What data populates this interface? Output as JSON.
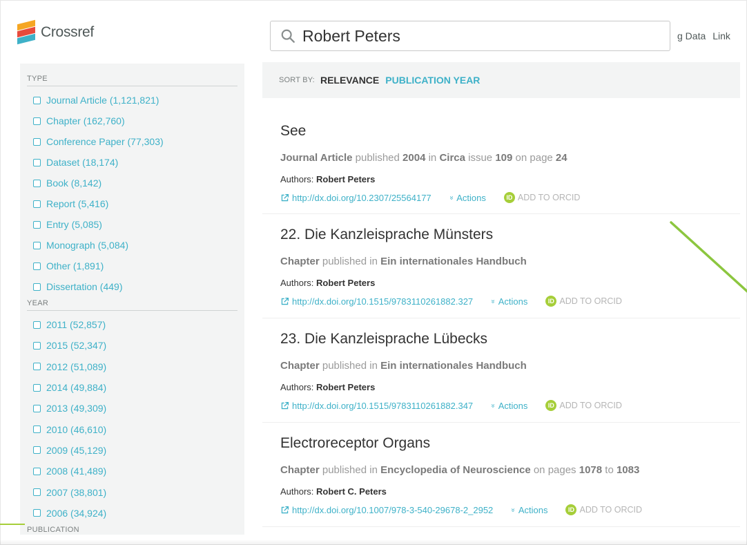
{
  "brand": {
    "name": "Crossref"
  },
  "search": {
    "query": "Robert Peters"
  },
  "top_nav": {
    "items": [
      "g Data",
      "Link"
    ]
  },
  "sidebar": {
    "type_heading": "TYPE",
    "type_items": [
      "Journal Article (1,121,821)",
      "Chapter (162,760)",
      "Conference Paper (77,303)",
      "Dataset (18,174)",
      "Book (8,142)",
      "Report (5,416)",
      "Entry (5,085)",
      "Monograph (5,084)",
      "Other (1,891)",
      "Dissertation (449)"
    ],
    "year_heading": "YEAR",
    "year_items": [
      "2011 (52,857)",
      "2015 (52,347)",
      "2012 (51,089)",
      "2014 (49,884)",
      "2013 (49,309)",
      "2010 (46,610)",
      "2009 (45,129)",
      "2008 (41,489)",
      "2007 (38,801)",
      "2006 (34,924)"
    ],
    "publication_heading": "PUBLICATION"
  },
  "sort": {
    "label": "SORT BY:",
    "active": "RELEVANCE",
    "alternate": "PUBLICATION YEAR"
  },
  "common": {
    "authors_label": "Authors:",
    "actions_label": "Actions",
    "orcid_label": "ADD TO ORCID",
    "orcid_badge": "iD"
  },
  "results": [
    {
      "title": "See",
      "meta": [
        {
          "text": "Journal Article",
          "bold": true
        },
        {
          "text": " published ",
          "bold": false
        },
        {
          "text": "2004",
          "bold": true
        },
        {
          "text": " in ",
          "bold": false
        },
        {
          "text": "Circa",
          "bold": true
        },
        {
          "text": " issue ",
          "bold": false
        },
        {
          "text": "109",
          "bold": true
        },
        {
          "text": " on page ",
          "bold": false
        },
        {
          "text": "24",
          "bold": true
        }
      ],
      "authors": "Robert Peters",
      "doi": "http://dx.doi.org/10.2307/25564177"
    },
    {
      "title": "22. Die Kanzleisprache Münsters",
      "meta": [
        {
          "text": "Chapter",
          "bold": true
        },
        {
          "text": " published in ",
          "bold": false
        },
        {
          "text": "Ein internationales Handbuch",
          "bold": true
        }
      ],
      "authors": "Robert Peters",
      "doi": "http://dx.doi.org/10.1515/9783110261882.327"
    },
    {
      "title": "23. Die Kanzleisprache Lübecks",
      "meta": [
        {
          "text": "Chapter",
          "bold": true
        },
        {
          "text": " published in ",
          "bold": false
        },
        {
          "text": "Ein internationales Handbuch",
          "bold": true
        }
      ],
      "authors": "Robert Peters",
      "doi": "http://dx.doi.org/10.1515/9783110261882.347"
    },
    {
      "title": "Electroreceptor Organs",
      "meta": [
        {
          "text": "Chapter",
          "bold": true
        },
        {
          "text": " published in ",
          "bold": false
        },
        {
          "text": "Encyclopedia of Neuroscience",
          "bold": true
        },
        {
          "text": " on pages ",
          "bold": false
        },
        {
          "text": "1078",
          "bold": true
        },
        {
          "text": " to ",
          "bold": false
        },
        {
          "text": "1083",
          "bold": true
        }
      ],
      "authors": "Robert C. Peters",
      "doi": "http://dx.doi.org/10.1007/978-3-540-29678-2_2952"
    }
  ],
  "colors": {
    "accent": "#3eb1c8",
    "orcid": "#a6ce39",
    "sidebar_bg": "#f3f4f4"
  }
}
